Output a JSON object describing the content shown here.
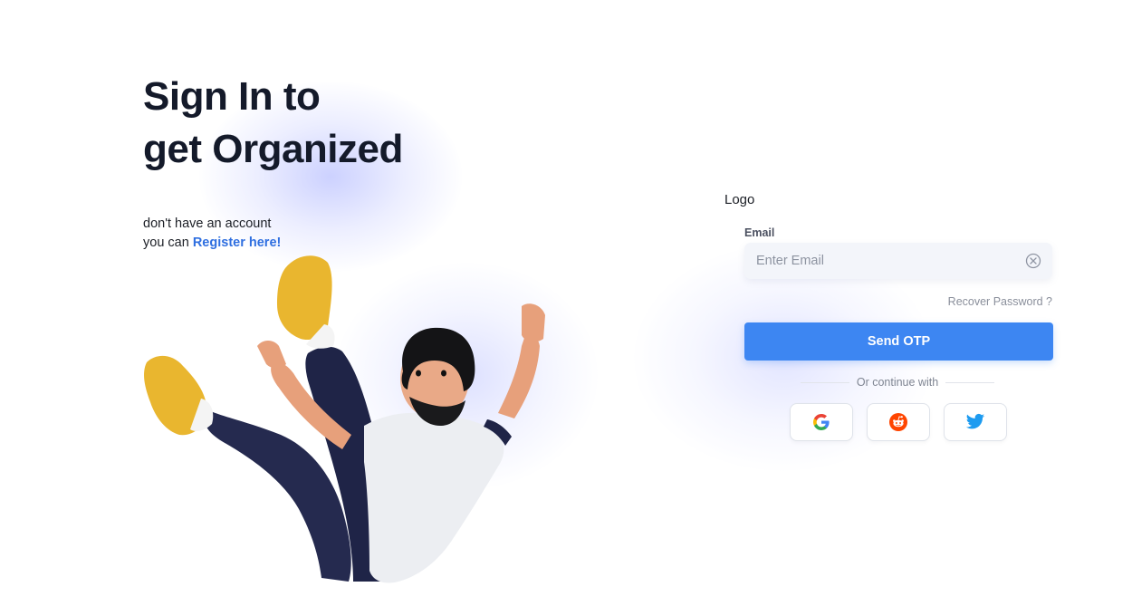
{
  "hero": {
    "title_line_1": "Sign In to",
    "title_line_2": "get Organized",
    "account_text": "don't have an account",
    "register_prefix": "you can",
    "register_link": "Register here!"
  },
  "form": {
    "logo": "Logo",
    "email_label": "Email",
    "email_placeholder": "Enter Email",
    "email_value": "",
    "recover_password": "Recover Password ?",
    "send_otp": "Send OTP",
    "continue_with": "Or continue with"
  },
  "social": [
    {
      "name": "google",
      "icon": "google-icon"
    },
    {
      "name": "reddit",
      "icon": "reddit-icon"
    },
    {
      "name": "twitter",
      "icon": "twitter-icon"
    }
  ],
  "colors": {
    "primary": "#3d86f2",
    "link": "#2f6fe0",
    "heading": "#141a2a",
    "input_bg": "#f3f5fa",
    "reddit": "#ff4500",
    "twitter": "#1d9bf0"
  }
}
